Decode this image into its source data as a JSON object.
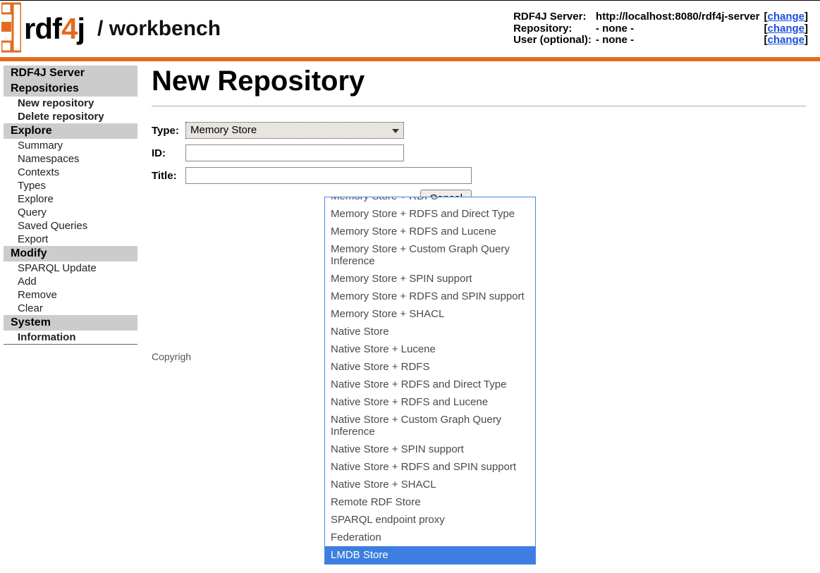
{
  "logo": {
    "pre": "rdf",
    "highlight": "4",
    "post": "j",
    "sub": "/ workbench"
  },
  "server": {
    "rows": [
      {
        "label": "RDF4J Server:",
        "value": "http://localhost:8080/rdf4j-server",
        "change": "change"
      },
      {
        "label": "Repository:",
        "value": "- none -",
        "change": "change"
      },
      {
        "label": "User (optional):",
        "value": "- none -",
        "change": "change"
      }
    ]
  },
  "sidebar": {
    "groups": [
      {
        "header": "RDF4J Server",
        "items": []
      },
      {
        "header": "Repositories",
        "items": [
          {
            "label": "New repository",
            "bold": true
          },
          {
            "label": "Delete repository",
            "bold": true
          }
        ]
      },
      {
        "header": "Explore",
        "items": [
          {
            "label": "Summary"
          },
          {
            "label": "Namespaces"
          },
          {
            "label": "Contexts"
          },
          {
            "label": "Types"
          },
          {
            "label": "Explore"
          },
          {
            "label": "Query"
          },
          {
            "label": "Saved Queries"
          },
          {
            "label": "Export"
          }
        ]
      },
      {
        "header": "Modify",
        "items": [
          {
            "label": "SPARQL Update"
          },
          {
            "label": "Add"
          },
          {
            "label": "Remove"
          },
          {
            "label": "Clear"
          }
        ]
      },
      {
        "header": "System",
        "items": [
          {
            "label": "Information",
            "bold": true
          }
        ]
      }
    ]
  },
  "page": {
    "title": "New Repository",
    "form": {
      "type_label": "Type:",
      "type_value": "Memory Store",
      "id_label": "ID:",
      "id_value": "",
      "title_label": "Title:",
      "title_value": "",
      "cancel": "Cancel"
    }
  },
  "dropdown": {
    "items": [
      "Memory Store + RDFS",
      "Memory Store + RDFS and Direct Type",
      "Memory Store + RDFS and Lucene",
      "Memory Store + Custom Graph Query Inference",
      "Memory Store + SPIN support",
      "Memory Store + RDFS and SPIN support",
      "Memory Store + SHACL",
      "Native Store",
      "Native Store + Lucene",
      "Native Store + RDFS",
      "Native Store + RDFS and Direct Type",
      "Native Store + RDFS and Lucene",
      "Native Store + Custom Graph Query Inference",
      "Native Store + SPIN support",
      "Native Store + RDFS and SPIN support",
      "Native Store + SHACL",
      "Remote RDF Store",
      "SPARQL endpoint proxy",
      "Federation",
      "LMDB Store"
    ],
    "highlighted_index": 19
  },
  "copyright": "Copyrigh"
}
